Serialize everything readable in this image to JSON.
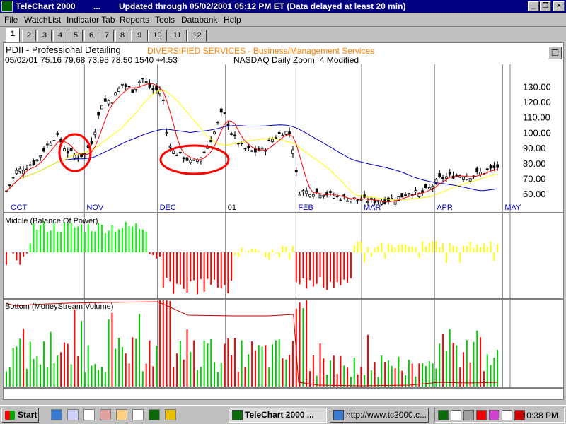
{
  "window": {
    "title": "TeleChart 2000",
    "dots": "...",
    "updated": "Updated through 05/02/2001  05:12 PM ET  (Data delayed at least 20 min)"
  },
  "menu": [
    "File",
    "WatchList",
    "Indicator Tab",
    "Reports",
    "Tools",
    "Databank",
    "Help"
  ],
  "tabs": [
    "1",
    "2",
    "3",
    "4",
    "5",
    "6",
    "7",
    "8",
    "9",
    "10",
    "11",
    "12"
  ],
  "active_tab": "1",
  "chart_header": {
    "symbol_name": "PDII - Professional Detailing",
    "sector": "DIVERSIFIED SERVICES - Business/Management Services",
    "quote_line": "05/02/01  75.16  79.68  73.95  78.50  1540  +4.53",
    "exchange_info": "NASDAQ  Daily  Zoom=4  Modified"
  },
  "panes": {
    "middle_label": "Middle (Balance Of Power)",
    "bottom_label": "Bottom (MoneyStream  Volume)"
  },
  "chart_data": [
    {
      "type": "candlestick",
      "title": "",
      "x_labels": [
        "OCT",
        "NOV",
        "DEC",
        "01",
        "FEB",
        "MAR",
        "APR",
        "MAY"
      ],
      "y_ticks": [
        "130.00",
        "120.00",
        "110.00",
        "100.00",
        "90.00",
        "80.00",
        "70.00",
        "60.00"
      ],
      "ylim": [
        55,
        138
      ],
      "series": [
        {
          "name": "",
          "color": "#ff0000",
          "note": "short moving average"
        },
        {
          "name": "",
          "color": "#ffff00",
          "note": "medium moving average"
        },
        {
          "name": "",
          "color": "#0000c0",
          "note": "long moving average"
        }
      ],
      "price_path": [
        [
          0,
          62
        ],
        [
          0.02,
          75
        ],
        [
          0.04,
          78
        ],
        [
          0.06,
          82
        ],
        [
          0.08,
          92
        ],
        [
          0.1,
          99
        ],
        [
          0.12,
          88
        ],
        [
          0.14,
          85
        ],
        [
          0.155,
          86
        ],
        [
          0.17,
          95
        ],
        [
          0.19,
          120
        ],
        [
          0.21,
          122
        ],
        [
          0.23,
          132
        ],
        [
          0.25,
          128
        ],
        [
          0.27,
          136
        ],
        [
          0.29,
          128
        ],
        [
          0.31,
          128
        ],
        [
          0.315,
          104
        ],
        [
          0.33,
          88
        ],
        [
          0.35,
          85
        ],
        [
          0.37,
          80
        ],
        [
          0.39,
          86
        ],
        [
          0.41,
          98
        ],
        [
          0.43,
          115
        ],
        [
          0.45,
          98
        ],
        [
          0.47,
          90
        ],
        [
          0.49,
          88
        ],
        [
          0.51,
          89
        ],
        [
          0.53,
          97
        ],
        [
          0.55,
          101
        ],
        [
          0.565,
          100
        ],
        [
          0.58,
          62
        ],
        [
          0.6,
          62
        ],
        [
          0.63,
          61
        ],
        [
          0.66,
          58
        ],
        [
          0.69,
          57
        ],
        [
          0.72,
          56
        ],
        [
          0.75,
          56
        ],
        [
          0.78,
          58
        ],
        [
          0.8,
          62
        ],
        [
          0.82,
          60
        ],
        [
          0.84,
          64
        ],
        [
          0.86,
          70
        ],
        [
          0.88,
          72
        ],
        [
          0.9,
          73
        ],
        [
          0.92,
          72
        ],
        [
          0.94,
          74
        ],
        [
          0.96,
          76
        ],
        [
          0.975,
          78
        ]
      ]
    },
    {
      "type": "bar",
      "title": "Middle (Balance Of Power)",
      "colors": {
        "up": "#00ff00",
        "down": "#ff0000",
        "neutral": "#ffff00"
      }
    },
    {
      "type": "bar",
      "title": "Bottom (MoneyStream  Volume)",
      "colors": {
        "up": "#00cc00",
        "down": "#ff0000",
        "line": "#cc0000"
      }
    }
  ],
  "taskbar": {
    "start": "Start",
    "quicklaunch": [
      "ie-icon",
      "desktop-icon",
      "ftp-icon",
      "tools-icon",
      "app-icon",
      "notepad-icon",
      "chart-icon",
      "winamp-icon"
    ],
    "tasks": [
      {
        "label": "TeleChart 2000  ...",
        "active": true
      },
      {
        "label": "http://www.tc2000.c...",
        "active": false
      }
    ],
    "clock": "10:38 PM"
  }
}
